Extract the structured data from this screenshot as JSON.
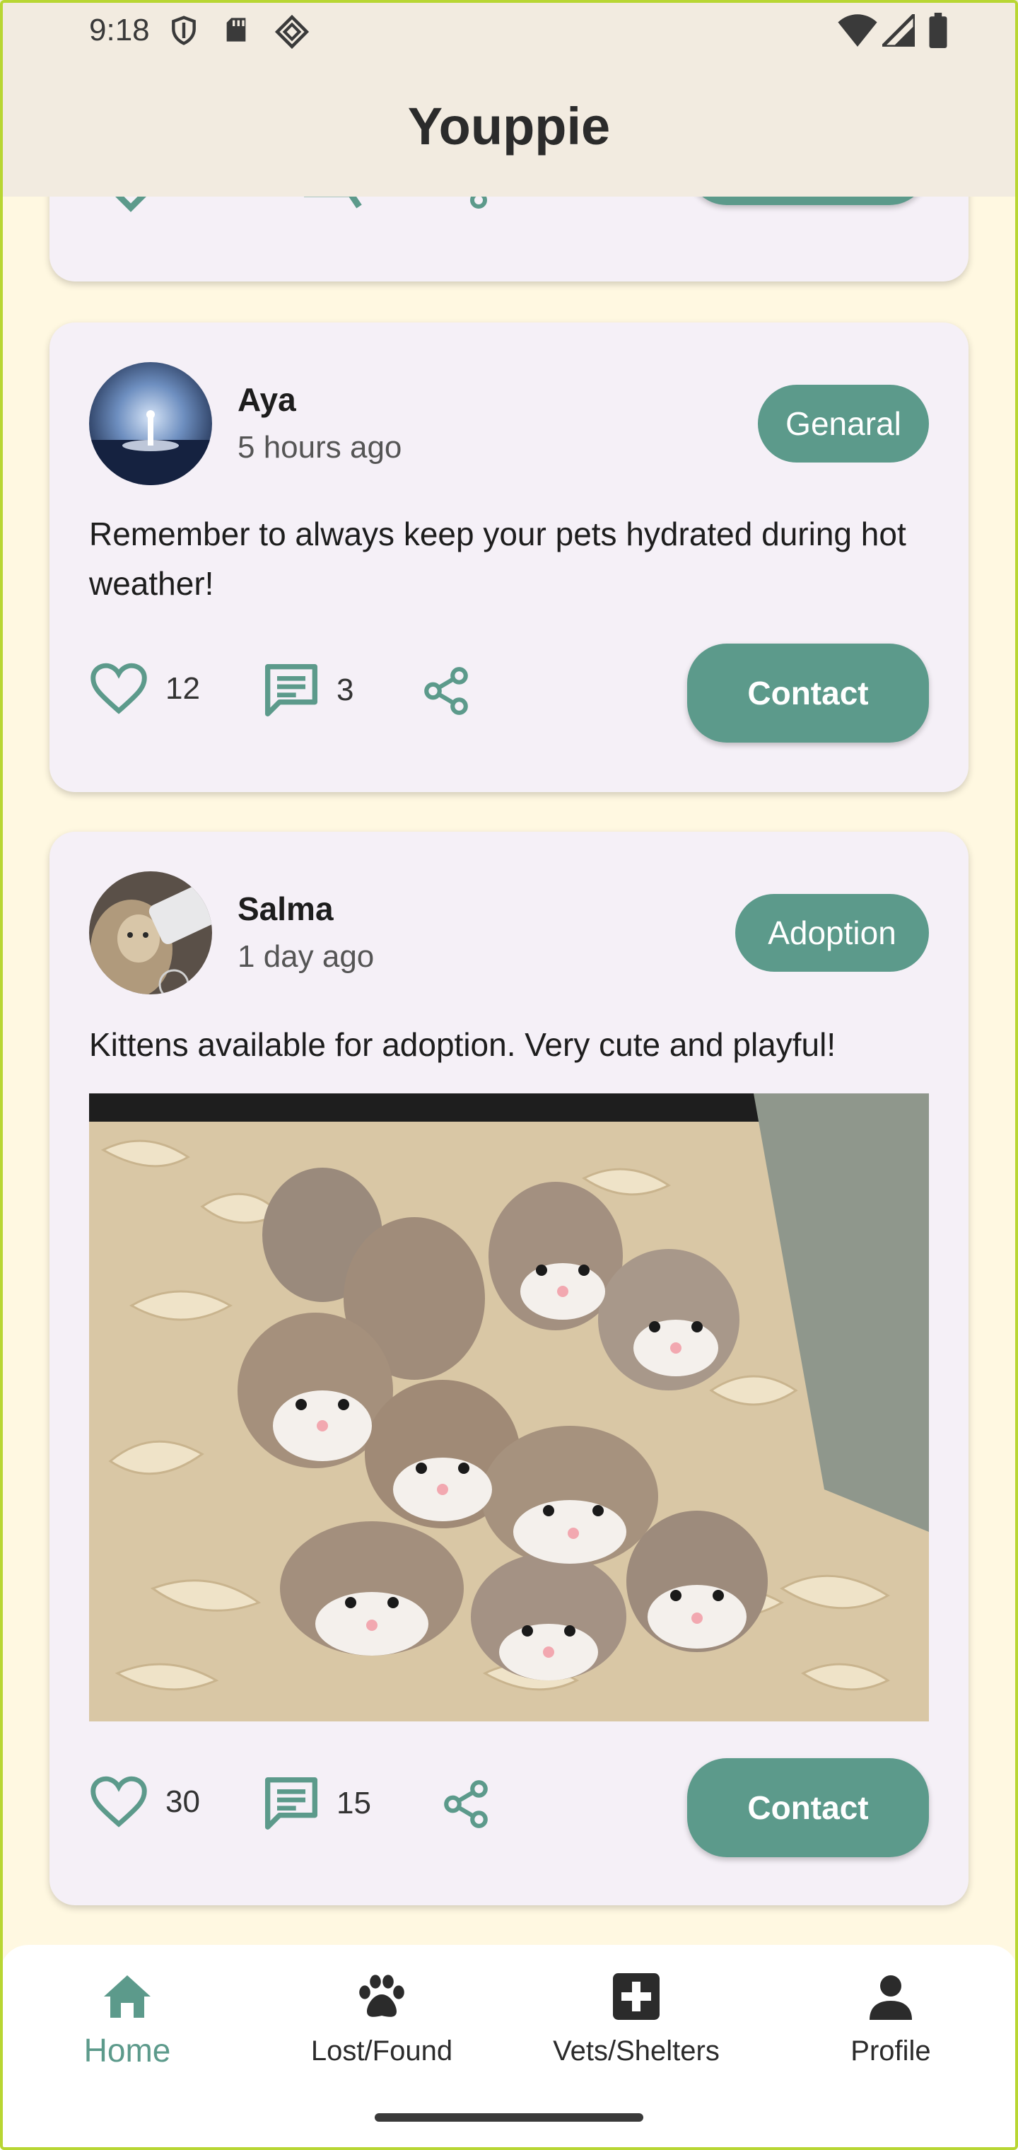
{
  "status_bar": {
    "time": "9:18",
    "left_icons": [
      "shield-icon",
      "sd-card-icon",
      "app-diamond-icon"
    ],
    "right_icons": [
      "wifi-icon",
      "signal-icon",
      "battery-icon"
    ]
  },
  "app_bar": {
    "title": "Youppie"
  },
  "colors": {
    "accent": "#5C9A8B",
    "background": "#FFF8E1",
    "card": "#F5F0F7",
    "app_bar": "#F2EBE0"
  },
  "posts": [
    {
      "author": "Aya",
      "time": "5 hours ago",
      "category": "Genaral",
      "text": "Remember to always keep your pets hydrated during hot weather!",
      "likes": "12",
      "comments": "3",
      "contact_label": "Contact"
    },
    {
      "author": "Salma",
      "time": "1 day ago",
      "category": "Adoption",
      "text": "Kittens available for adoption. Very cute and playful!",
      "likes": "30",
      "comments": "15",
      "contact_label": "Contact"
    }
  ],
  "bottom_nav": {
    "items": [
      {
        "label": "Home",
        "icon": "home-icon",
        "active": true
      },
      {
        "label": "Lost/Found",
        "icon": "paw-icon",
        "active": false
      },
      {
        "label": "Vets/Shelters",
        "icon": "medical-cross-icon",
        "active": false
      },
      {
        "label": "Profile",
        "icon": "person-icon",
        "active": false
      }
    ]
  }
}
